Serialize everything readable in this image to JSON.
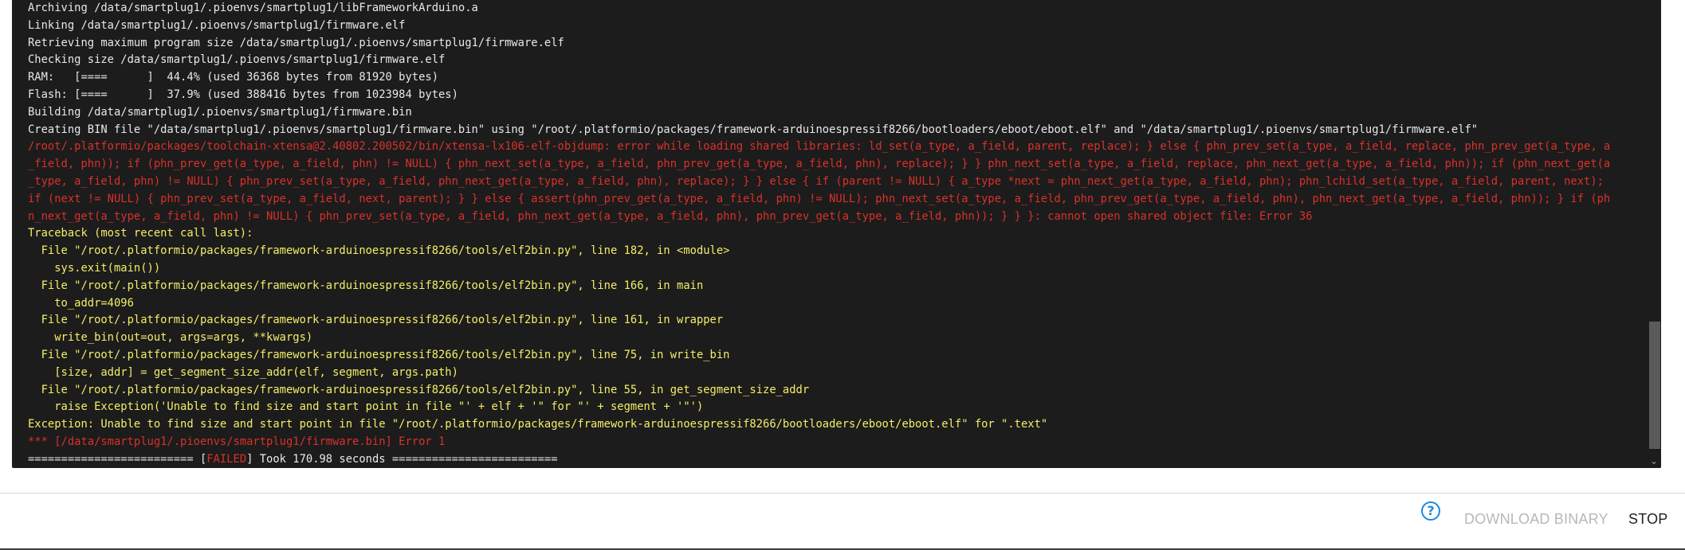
{
  "log": {
    "lines": [
      {
        "text": "Archiving /data/smartplug1/.pioenvs/smartplug1/libFrameworkArduino.a",
        "tone": "white"
      },
      {
        "text": "Linking /data/smartplug1/.pioenvs/smartplug1/firmware.elf",
        "tone": "white"
      },
      {
        "text": "Retrieving maximum program size /data/smartplug1/.pioenvs/smartplug1/firmware.elf",
        "tone": "white"
      },
      {
        "text": "Checking size /data/smartplug1/.pioenvs/smartplug1/firmware.elf",
        "tone": "white"
      },
      {
        "text": "RAM:   [====      ]  44.4% (used 36368 bytes from 81920 bytes)",
        "tone": "white"
      },
      {
        "text": "Flash: [====      ]  37.9% (used 388416 bytes from 1023984 bytes)",
        "tone": "white"
      },
      {
        "text": "Building /data/smartplug1/.pioenvs/smartplug1/firmware.bin",
        "tone": "white"
      },
      {
        "text": "Creating BIN file \"/data/smartplug1/.pioenvs/smartplug1/firmware.bin\" using \"/root/.platformio/packages/framework-arduinoespressif8266/bootloaders/eboot/eboot.elf\" and \"/data/smartplug1/.pioenvs/smartplug1/firmware.elf\"",
        "tone": "white"
      },
      {
        "text": "/root/.platformio/packages/toolchain-xtensa@2.40802.200502/bin/xtensa-lx106-elf-objdump: error while loading shared libraries: ld_set(a_type, a_field, parent, replace); } else { phn_prev_set(a_type, a_field, replace, phn_prev_get(a_type, a_field, phn)); if (phn_prev_get(a_type, a_field, phn) != NULL) { phn_next_set(a_type, a_field, phn_prev_get(a_type, a_field, phn), replace); } } phn_next_set(a_type, a_field, replace, phn_next_get(a_type, a_field, phn)); if (phn_next_get(a_type, a_field, phn) != NULL) { phn_prev_set(a_type, a_field, phn_next_get(a_type, a_field, phn), replace); } } else { if (parent != NULL) { a_type *next = phn_next_get(a_type, a_field, phn); phn_lchild_set(a_type, a_field, parent, next); if (next != NULL) { phn_prev_set(a_type, a_field, next, parent); } } else { assert(phn_prev_get(a_type, a_field, phn) != NULL); phn_next_set(a_type, a_field, phn_prev_get(a_type, a_field, phn), phn_next_get(a_type, a_field, phn)); } if (phn_next_get(a_type, a_field, phn) != NULL) { phn_prev_set(a_type, a_field, phn_next_get(a_type, a_field, phn), phn_prev_get(a_type, a_field, phn)); } } }: cannot open shared object file: Error 36",
        "tone": "red",
        "wrap": true
      },
      {
        "text": "Traceback (most recent call last):",
        "tone": "yellow"
      },
      {
        "text": "  File \"/root/.platformio/packages/framework-arduinoespressif8266/tools/elf2bin.py\", line 182, in <module>",
        "tone": "yellow"
      },
      {
        "text": "    sys.exit(main())",
        "tone": "yellow"
      },
      {
        "text": "  File \"/root/.platformio/packages/framework-arduinoespressif8266/tools/elf2bin.py\", line 166, in main",
        "tone": "yellow"
      },
      {
        "text": "    to_addr=4096",
        "tone": "yellow"
      },
      {
        "text": "  File \"/root/.platformio/packages/framework-arduinoespressif8266/tools/elf2bin.py\", line 161, in wrapper",
        "tone": "yellow"
      },
      {
        "text": "    write_bin(out=out, args=args, **kwargs)",
        "tone": "yellow"
      },
      {
        "text": "  File \"/root/.platformio/packages/framework-arduinoespressif8266/tools/elf2bin.py\", line 75, in write_bin",
        "tone": "yellow"
      },
      {
        "text": "    [size, addr] = get_segment_size_addr(elf, segment, args.path)",
        "tone": "yellow"
      },
      {
        "text": "  File \"/root/.platformio/packages/framework-arduinoespressif8266/tools/elf2bin.py\", line 55, in get_segment_size_addr",
        "tone": "yellow"
      },
      {
        "text": "    raise Exception('Unable to find size and start point in file \"' + elf + '\" for \"' + segment + '\"')",
        "tone": "yellow"
      },
      {
        "text": "Exception: Unable to find size and start point in file \"/root/.platformio/packages/framework-arduinoespressif8266/bootloaders/eboot/eboot.elf\" for \".text\"",
        "tone": "yellow"
      },
      {
        "text": "*** [/data/smartplug1/.pioenvs/smartplug1/firmware.bin] Error 1",
        "tone": "red"
      }
    ],
    "summary": {
      "prefix": "========================= [",
      "status": "FAILED",
      "suffix": "] Took 170.98 seconds ========================="
    }
  },
  "colors": {
    "terminal_bg": "#1c1c1c",
    "text_white": "#e8e8e8",
    "error_red": "#d9312a",
    "traceback_yellow": "#f3ee68",
    "help_blue": "#1e88e5"
  },
  "footer": {
    "help_icon": "help-circle-icon",
    "help_glyph": "?",
    "download_label": "DOWNLOAD BINARY",
    "stop_label": "STOP"
  },
  "scrollbar": {
    "arrow_glyph": "⌄"
  }
}
